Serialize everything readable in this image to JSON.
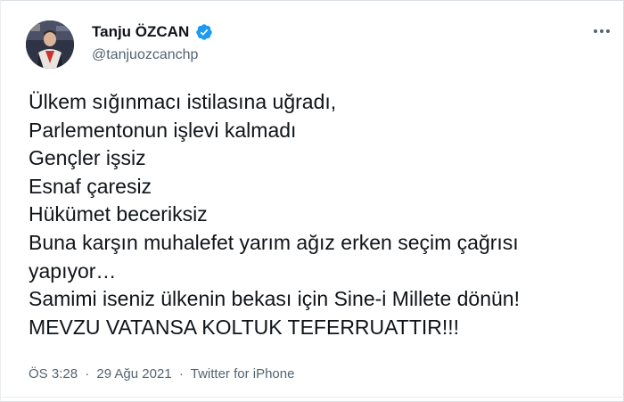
{
  "tweet": {
    "author": {
      "name": "Tanju ÖZCAN",
      "handle": "@tanjuozcanchp",
      "verified": true
    },
    "lines": [
      "Ülkem sığınmacı istilasına uğradı,",
      "Parlementonun işlevi kalmadı",
      "Gençler işsiz",
      "Esnaf çaresiz",
      "Hükümet beceriksiz",
      "Buna karşın muhalefet yarım ağız erken seçim çağrısı",
      "yapıyor…",
      "Samimi iseniz ülkenin bekası için Sine-i Millete dönün!",
      "MEVZU VATANSA KOLTUK TEFERRUATTIR!!!"
    ],
    "time": "ÖS 3:28",
    "date": "29 Ağu 2021",
    "separator": "·",
    "source": "Twitter for iPhone"
  },
  "icons": {
    "verified": "verified-badge-icon",
    "more": "more-horizontal-icon"
  },
  "colors": {
    "text": "#0f1419",
    "muted": "#536471",
    "verified": "#1d9bf0",
    "border": "#d9dfe3"
  }
}
